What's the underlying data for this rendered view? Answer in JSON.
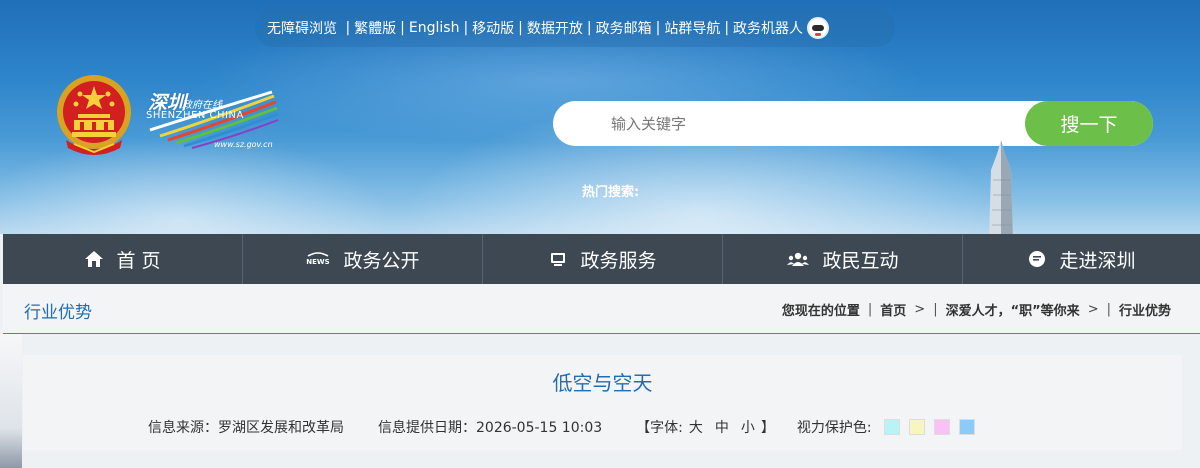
{
  "topbar": {
    "links": [
      "无障碍浏览",
      "繁體版",
      "English",
      "移动版",
      "数据开放",
      "政务邮箱",
      "站群导航",
      "政务机器人"
    ]
  },
  "logo": {
    "cn": "深圳",
    "sub": "政府在线",
    "en": "SHENZHEN CHINA",
    "url": "www.sz.gov.cn"
  },
  "search": {
    "placeholder": "输入关键字",
    "button_label": "搜一下",
    "hot_label": "热门搜索:"
  },
  "nav": {
    "items": [
      {
        "label": "首 页",
        "icon": "home-icon"
      },
      {
        "label": "政务公开",
        "icon": "news-icon"
      },
      {
        "label": "政务服务",
        "icon": "monitor-icon"
      },
      {
        "label": "政民互动",
        "icon": "users-icon"
      },
      {
        "label": "走进深圳",
        "icon": "chat-icon"
      }
    ]
  },
  "section": {
    "title": "行业优势"
  },
  "breadcrumb": {
    "prefix": "您现在的位置",
    "items": [
      "首页",
      "深爱人才，“职”等你来",
      "行业优势"
    ]
  },
  "article": {
    "title": "低空与空天",
    "source_label": "信息来源：罗湖区发展和改革局",
    "date_label": "信息提供日期：2026-05-15 10:03",
    "font_open": "【字体:",
    "font_sizes": [
      "大",
      "中",
      "小"
    ],
    "font_close": "】",
    "vision_label": "视力保护色:"
  },
  "colors": {
    "accent": "#1f6db2",
    "nav_bg": "#3d4852",
    "search_button": "#6cc04a",
    "swatches": [
      "#b8f3f7",
      "#f8f6c0",
      "#f9c2f5",
      "#8ccaf7"
    ]
  }
}
